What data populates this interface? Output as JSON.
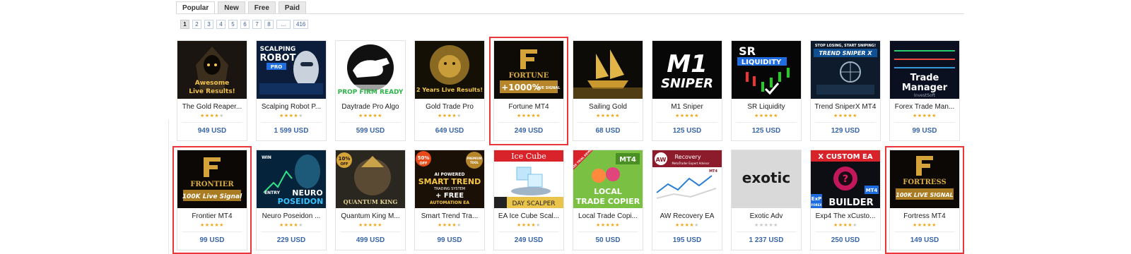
{
  "tabs": [
    {
      "label": "Popular",
      "active": true
    },
    {
      "label": "New",
      "active": false
    },
    {
      "label": "Free",
      "active": false
    },
    {
      "label": "Paid",
      "active": false
    }
  ],
  "pagination": [
    "1",
    "2",
    "3",
    "4",
    "5",
    "6",
    "7",
    "8",
    "...",
    "416"
  ],
  "current_page": "1",
  "colors": {
    "star": "#f0a81c",
    "price": "#3a66a8",
    "highlight": "#e8363a"
  },
  "products": [
    {
      "name": "The Gold Reaper...",
      "price": "949 USD",
      "rating": 4.5,
      "thumb_text": [
        "Awesome",
        "Live Results!"
      ],
      "thumb_style": "reaper",
      "highlighted": false
    },
    {
      "name": "Scalping Robot P...",
      "price": "1 599 USD",
      "rating": 4,
      "thumb_text": [
        "SCALPING",
        "ROBOT",
        "PRO"
      ],
      "thumb_style": "robot",
      "highlighted": false
    },
    {
      "name": "Daytrade Pro Algo",
      "price": "599 USD",
      "rating": 5,
      "thumb_text": [
        "PROP FIRM READY"
      ],
      "thumb_style": "bull",
      "highlighted": false
    },
    {
      "name": "Gold Trade Pro",
      "price": "649 USD",
      "rating": 4.5,
      "thumb_text": [
        "2 Years Live Results!"
      ],
      "thumb_style": "lion",
      "highlighted": false
    },
    {
      "name": "Fortune MT4",
      "price": "249 USD",
      "rating": 5,
      "thumb_text": [
        "FORTUNE",
        "+1000%",
        "LIVE SIGNAL"
      ],
      "thumb_style": "fortune",
      "highlighted": true
    },
    {
      "name": "Sailing Gold",
      "price": "68 USD",
      "rating": 5,
      "thumb_text": [],
      "thumb_style": "ship",
      "highlighted": false
    },
    {
      "name": "M1 Sniper",
      "price": "125 USD",
      "rating": 5,
      "thumb_text": [
        "M1",
        "SNIPER"
      ],
      "thumb_style": "m1",
      "highlighted": false
    },
    {
      "name": "SR Liquidity",
      "price": "125 USD",
      "rating": 5,
      "thumb_text": [
        "SR",
        "LIQUIDITY"
      ],
      "thumb_style": "sr",
      "highlighted": false
    },
    {
      "name": "Trend SniperX MT4",
      "price": "129 USD",
      "rating": 5,
      "thumb_text": [
        "STOP LOSING, START SNIPING!",
        "TREND SNIPER X"
      ],
      "thumb_style": "sniperx",
      "highlighted": false
    },
    {
      "name": "Forex Trade Man...",
      "price": "99 USD",
      "rating": 5,
      "thumb_text": [
        "Trade",
        "Manager",
        "InvestSoft"
      ],
      "thumb_style": "manager",
      "highlighted": false
    },
    {
      "name": "Frontier MT4",
      "price": "99 USD",
      "rating": 5,
      "thumb_text": [
        "FRONTIER",
        "100K Live Signal"
      ],
      "thumb_style": "frontier",
      "highlighted": true
    },
    {
      "name": "Neuro Poseidon ...",
      "price": "229 USD",
      "rating": 4.5,
      "thumb_text": [
        "WIN",
        "ENTRY",
        "NEURO",
        "POSEIDON"
      ],
      "thumb_style": "poseidon",
      "highlighted": false
    },
    {
      "name": "Quantum King M...",
      "price": "499 USD",
      "rating": 5,
      "thumb_text": [
        "10%",
        "OFF",
        "QUANTUM KING"
      ],
      "thumb_style": "qking",
      "highlighted": false
    },
    {
      "name": "Smart Trend Tra...",
      "price": "99 USD",
      "rating": 4.5,
      "thumb_text": [
        "50%",
        "OFF",
        "PREMIUM",
        "TOOL",
        "AI POWERED",
        "SMART TREND",
        "TRADING SYSTEM",
        "+ FREE",
        "AUTOMATION EA"
      ],
      "thumb_style": "smarttrend",
      "highlighted": false
    },
    {
      "name": "EA Ice Cube Scal...",
      "price": "249 USD",
      "rating": 4.5,
      "thumb_text": [
        "Ice Cube",
        "DAY SCALPER"
      ],
      "thumb_style": "icecube",
      "highlighted": false
    },
    {
      "name": "Local Trade Copi...",
      "price": "50 USD",
      "rating": 5,
      "thumb_text": [
        "FREE TRIAL DEMO",
        "MT4",
        "LOCAL",
        "TRADE COPIER"
      ],
      "thumb_style": "copier",
      "highlighted": false
    },
    {
      "name": "AW Recovery EA",
      "price": "195 USD",
      "rating": 4.5,
      "thumb_text": [
        "AW",
        "Recovery",
        "MetaTrader Expert Advisor",
        "MT4"
      ],
      "thumb_style": "recovery",
      "highlighted": false
    },
    {
      "name": "Exotic Adv",
      "price": "1 237 USD",
      "rating": 0,
      "thumb_text": [
        "exotic"
      ],
      "thumb_style": "exotic",
      "highlighted": false
    },
    {
      "name": "Exp4 The xCusto...",
      "price": "250 USD",
      "rating": 4,
      "thumb_text": [
        "X CUSTOM EA",
        "?",
        "ExP",
        "FOREX",
        "MT4",
        "BUILDER"
      ],
      "thumb_style": "xcustom",
      "highlighted": false
    },
    {
      "name": "Fortress MT4",
      "price": "149 USD",
      "rating": 5,
      "thumb_text": [
        "FORTRESS",
        "100K LIVE SIGNAL"
      ],
      "thumb_style": "fortress",
      "highlighted": true
    }
  ]
}
